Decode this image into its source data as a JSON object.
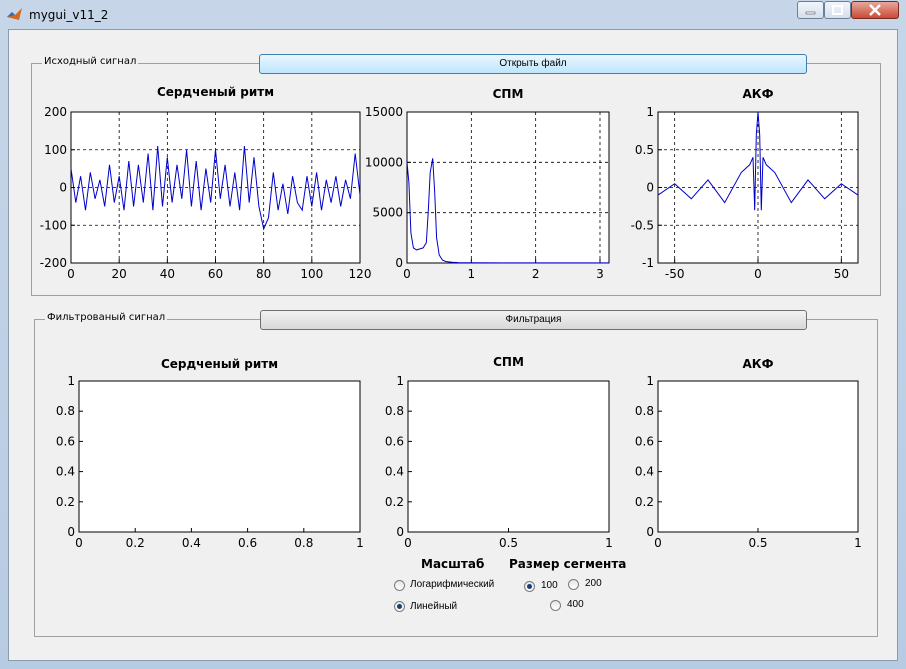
{
  "window": {
    "title": "mygui_v11_2"
  },
  "panels": {
    "source": {
      "title": "Исходный сигнал",
      "button": "Открыть файл"
    },
    "filtered": {
      "title": "Фильтрованый сигнал",
      "button": "Фильтрация"
    }
  },
  "controls": {
    "scale": {
      "label": "Масштаб",
      "options": [
        "Логарифмический",
        "Линейный"
      ],
      "selected": "Линейный"
    },
    "segment": {
      "label": "Размер сегмента",
      "options": [
        "100",
        "200",
        "400"
      ],
      "selected": "100"
    }
  },
  "colors": {
    "trace": "#0000cc",
    "selected_button": "#bee6fd"
  },
  "chart_data": [
    {
      "type": "line",
      "title": "Сердченый ритм",
      "xlim": [
        0,
        120
      ],
      "ylim": [
        -200,
        200
      ],
      "grid": true,
      "xticks": [
        "0",
        "20",
        "40",
        "60",
        "80",
        "100",
        "120"
      ],
      "yticks": [
        "200",
        "100",
        "0",
        "-100",
        "-200"
      ],
      "series": [
        {
          "x": [
            0,
            2,
            4,
            6,
            8,
            10,
            12,
            14,
            16,
            18,
            20,
            22,
            24,
            26,
            28,
            30,
            32,
            34,
            36,
            38,
            40,
            42,
            44,
            46,
            48,
            50,
            52,
            54,
            56,
            58,
            60,
            62,
            64,
            66,
            68,
            70,
            72,
            74,
            76,
            78,
            80,
            82,
            84,
            86,
            88,
            90,
            92,
            94,
            96,
            98,
            100,
            102,
            104,
            106,
            108,
            110,
            112,
            114,
            116,
            118,
            120
          ],
          "values": [
            50,
            -40,
            30,
            -60,
            40,
            -30,
            20,
            -50,
            60,
            -40,
            30,
            -60,
            70,
            -50,
            60,
            -40,
            90,
            -60,
            110,
            -50,
            80,
            -40,
            60,
            -30,
            100,
            -50,
            70,
            -60,
            50,
            -40,
            100,
            -30,
            60,
            -50,
            40,
            -60,
            110,
            -40,
            80,
            -50,
            -110,
            -80,
            40,
            -60,
            10,
            -70,
            30,
            -40,
            -60,
            30,
            -50,
            40,
            -60,
            20,
            -40,
            30,
            -50,
            20,
            -30,
            90,
            -20
          ]
        }
      ]
    },
    {
      "type": "line",
      "title": "СПМ",
      "xlim": [
        0,
        3.14
      ],
      "ylim": [
        0,
        15000
      ],
      "grid": true,
      "xticks": [
        "0",
        "1",
        "2",
        "3"
      ],
      "yticks": [
        "15000",
        "10000",
        "5000",
        "0"
      ],
      "series": [
        {
          "x": [
            0,
            0.03,
            0.06,
            0.1,
            0.15,
            0.2,
            0.25,
            0.3,
            0.33,
            0.36,
            0.4,
            0.43,
            0.46,
            0.5,
            0.55,
            0.6,
            0.7,
            0.8,
            1.0,
            1.5,
            2.0,
            2.5,
            3.14
          ],
          "values": [
            10000,
            8000,
            3000,
            1500,
            1300,
            1400,
            1500,
            2000,
            5000,
            9000,
            10400,
            7000,
            2500,
            800,
            300,
            150,
            80,
            40,
            20,
            10,
            5,
            5,
            5
          ]
        }
      ]
    },
    {
      "type": "line",
      "title": "АКФ",
      "xlim": [
        -60,
        60
      ],
      "ylim": [
        -1,
        1
      ],
      "grid": true,
      "xticks": [
        "-50",
        "0",
        "50"
      ],
      "yticks": [
        "1",
        "0.5",
        "0",
        "-0.5",
        "-1"
      ],
      "series": [
        {
          "x": [
            -60,
            -50,
            -40,
            -30,
            -20,
            -10,
            -5,
            -3,
            -2,
            -1,
            0,
            1,
            2,
            3,
            5,
            10,
            20,
            30,
            40,
            50,
            60
          ],
          "values": [
            -0.1,
            0.05,
            -0.15,
            0.1,
            -0.2,
            0.2,
            0.3,
            0.4,
            -0.3,
            0.7,
            1.0,
            0.7,
            -0.3,
            0.4,
            0.3,
            0.2,
            -0.2,
            0.1,
            -0.15,
            0.05,
            -0.1
          ]
        }
      ]
    },
    {
      "type": "line",
      "title": "Сердченый ритм",
      "xlim": [
        0,
        1
      ],
      "ylim": [
        0,
        1
      ],
      "grid": false,
      "xticks": [
        "0",
        "0.2",
        "0.4",
        "0.6",
        "0.8",
        "1"
      ],
      "yticks": [
        "1",
        "0.8",
        "0.6",
        "0.4",
        "0.2",
        "0"
      ],
      "series": []
    },
    {
      "type": "line",
      "title": "СПМ",
      "xlim": [
        0,
        1
      ],
      "ylim": [
        0,
        1
      ],
      "grid": false,
      "xticks": [
        "0",
        "0.5",
        "1"
      ],
      "yticks": [
        "1",
        "0.8",
        "0.6",
        "0.4",
        "0.2",
        "0"
      ],
      "series": []
    },
    {
      "type": "line",
      "title": "АКФ",
      "xlim": [
        0,
        1
      ],
      "ylim": [
        0,
        1
      ],
      "grid": false,
      "xticks": [
        "0",
        "0.5",
        "1"
      ],
      "yticks": [
        "1",
        "0.8",
        "0.6",
        "0.4",
        "0.2",
        "0"
      ],
      "series": []
    }
  ]
}
